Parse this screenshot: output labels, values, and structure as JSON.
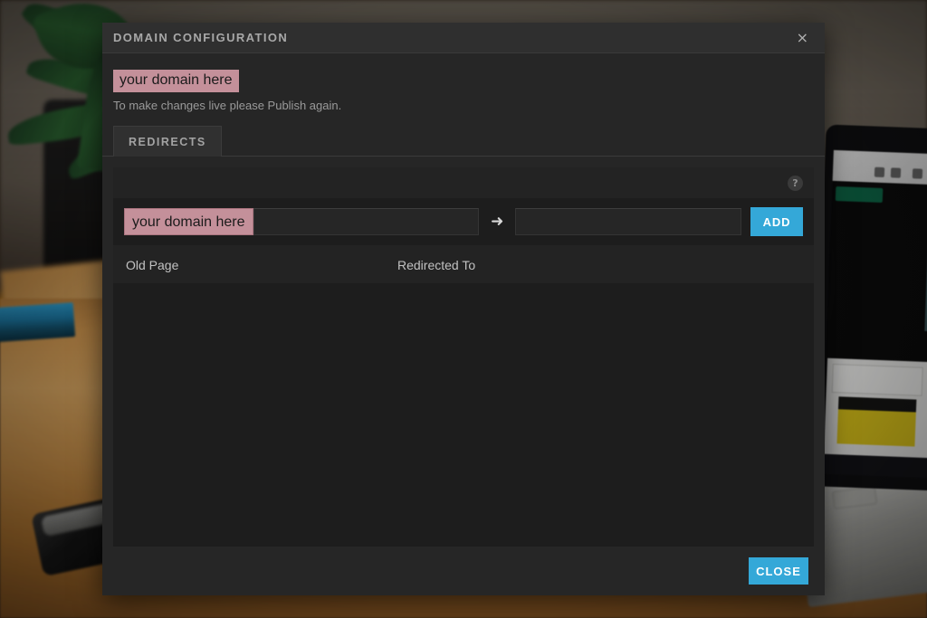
{
  "dialog": {
    "title": "DOMAIN CONFIGURATION",
    "close_icon": "×",
    "domain_chip": "your domain here",
    "note": "To make changes live please Publish again.",
    "tabs": [
      {
        "label": "REDIRECTS",
        "active": true
      }
    ],
    "toolbar": {
      "help_icon": "?"
    },
    "add_redirect": {
      "prefix_chip": "your domain here",
      "old_path_value": "",
      "old_path_placeholder": "",
      "arrow_icon": "➜",
      "new_url_value": "",
      "new_url_placeholder": "",
      "add_label": "ADD"
    },
    "table": {
      "columns": [
        "Old Page",
        "Redirected To"
      ],
      "rows": []
    },
    "footer": {
      "close_label": "CLOSE"
    }
  },
  "colors": {
    "accent": "#34a8d8",
    "chip_pink": "#c4909a",
    "dialog_bg": "#262626",
    "titlebar_bg": "#2f2f2f",
    "panel_bg": "#232323",
    "row_bg": "#1d1d1d"
  }
}
